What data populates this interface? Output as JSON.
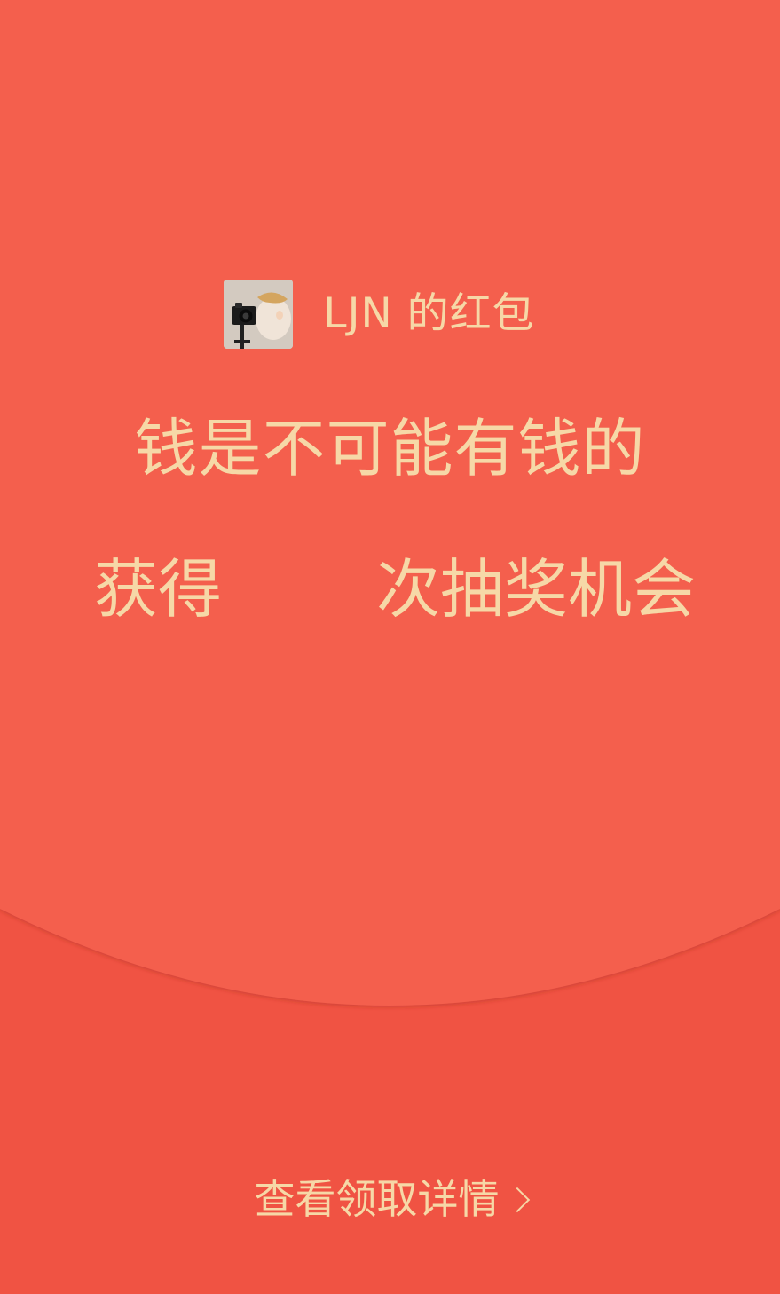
{
  "colors": {
    "envelope_top": "#f45e4d",
    "envelope_bottom": "#f05343",
    "accent_text": "#f6d8a7"
  },
  "sender": {
    "avatar_icon": "avatar-photo-icon",
    "name": "LJN 的红包"
  },
  "message": "钱是不可能有钱的",
  "prize": {
    "prefix": "获得",
    "count": "",
    "suffix": "次抽奖机会"
  },
  "details": {
    "label": "查看领取详情",
    "icon": "chevron-right-icon"
  }
}
